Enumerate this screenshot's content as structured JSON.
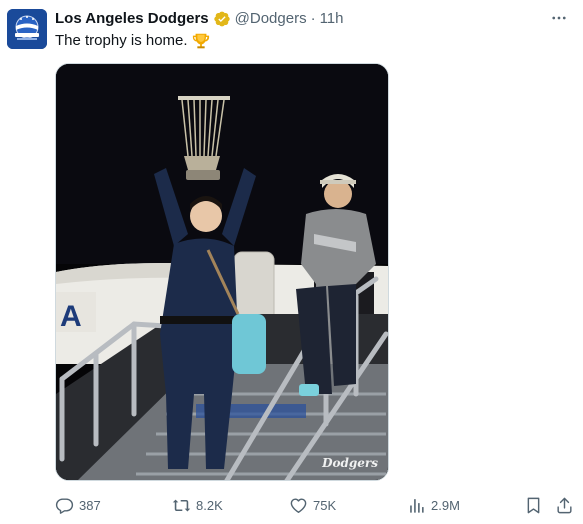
{
  "author": {
    "display_name": "Los Angeles Dodgers",
    "handle": "@Dodgers",
    "separator": "·",
    "time": "11h",
    "verified_icon": "verified-badge-icon",
    "avatar_icon": "world-series-champions-logo"
  },
  "tweet": {
    "text": "The trophy is home.",
    "emoji_icon": "trophy-icon"
  },
  "media": {
    "watermark": "Dodgers"
  },
  "actions": {
    "replies": "387",
    "reposts": "8.2K",
    "likes": "75K",
    "views": "2.9M"
  },
  "colors": {
    "text_primary": "#0f1419",
    "text_secondary": "#536471",
    "verified_gold": "#e2b719",
    "border": "#cfd9de"
  }
}
